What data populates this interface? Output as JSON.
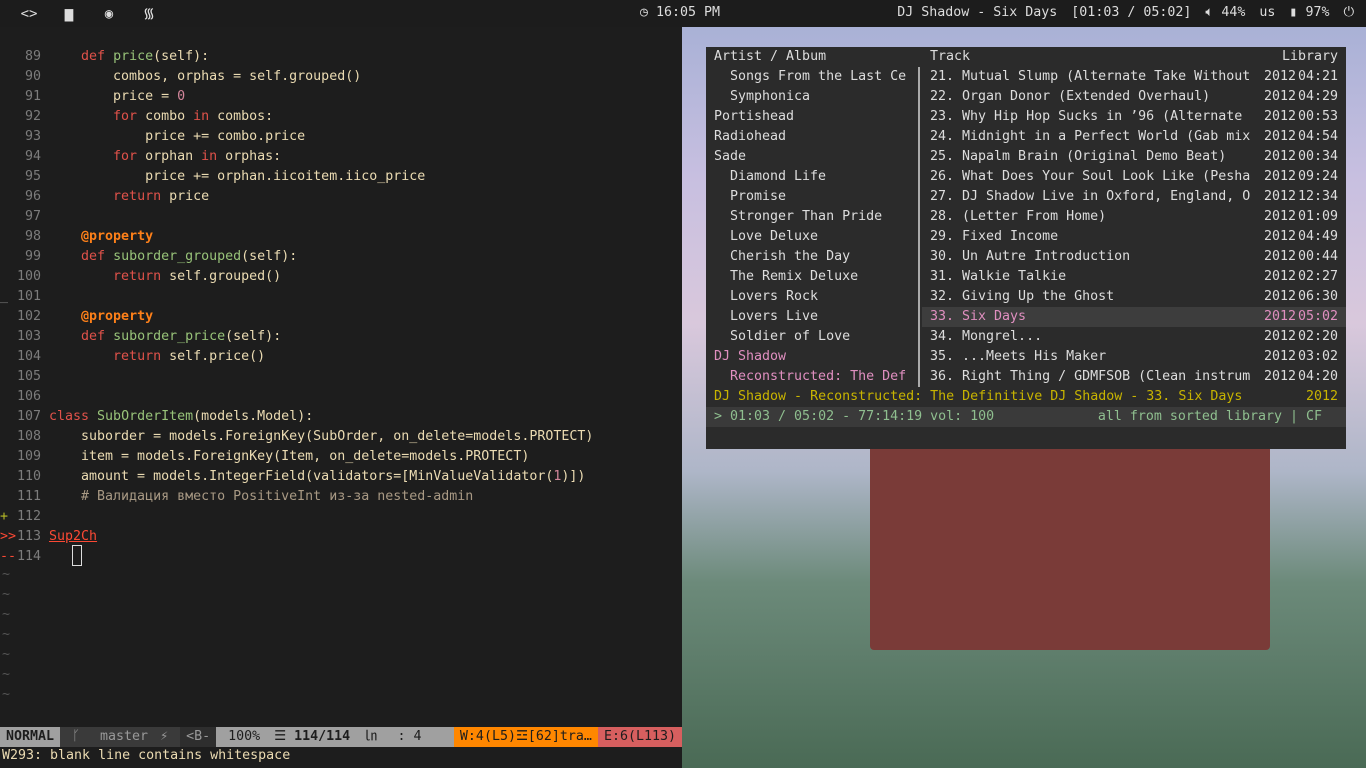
{
  "topbar": {
    "left_icons": [
      "code-icon",
      "folder-icon",
      "compass-icon",
      "rss-icon"
    ],
    "clock": "16:05 PM",
    "now_playing": "DJ Shadow - Six Days",
    "progress": "[01:03 / 05:02]",
    "volume": "44%",
    "layout": "us",
    "battery": "97%"
  },
  "editor": {
    "lines": [
      {
        "n": "89",
        "s": "",
        "t": [
          [
            "    ",
            ""
          ],
          [
            "def",
            "kw"
          ],
          [
            " ",
            ""
          ],
          [
            "price",
            "fn"
          ],
          [
            "(self):",
            ""
          ]
        ]
      },
      {
        "n": "90",
        "s": "",
        "t": [
          [
            "        combos, orphas = self.grouped()",
            ""
          ]
        ]
      },
      {
        "n": "91",
        "s": "",
        "t": [
          [
            "        price = ",
            ""
          ],
          [
            "0",
            "num"
          ]
        ]
      },
      {
        "n": "92",
        "s": "",
        "t": [
          [
            "        ",
            ""
          ],
          [
            "for",
            "kw"
          ],
          [
            " combo ",
            ""
          ],
          [
            "in",
            "kw"
          ],
          [
            " combos:",
            ""
          ]
        ]
      },
      {
        "n": "93",
        "s": "",
        "t": [
          [
            "            price += combo.price",
            ""
          ]
        ]
      },
      {
        "n": "94",
        "s": "",
        "t": [
          [
            "        ",
            ""
          ],
          [
            "for",
            "kw"
          ],
          [
            " orphan ",
            ""
          ],
          [
            "in",
            "kw"
          ],
          [
            " orphas:",
            ""
          ]
        ]
      },
      {
        "n": "95",
        "s": "",
        "t": [
          [
            "            price += orphan.iicoitem.iico_price",
            ""
          ]
        ]
      },
      {
        "n": "96",
        "s": "",
        "t": [
          [
            "        ",
            ""
          ],
          [
            "return",
            "kw"
          ],
          [
            " price",
            ""
          ]
        ]
      },
      {
        "n": "97",
        "s": "",
        "t": []
      },
      {
        "n": "98",
        "s": "",
        "t": [
          [
            "    ",
            ""
          ],
          [
            "@property",
            "dec"
          ]
        ]
      },
      {
        "n": "99",
        "s": "",
        "t": [
          [
            "    ",
            ""
          ],
          [
            "def",
            "kw"
          ],
          [
            " ",
            ""
          ],
          [
            "suborder_grouped",
            "fn"
          ],
          [
            "(self):",
            ""
          ]
        ]
      },
      {
        "n": "100",
        "s": "",
        "t": [
          [
            "        ",
            ""
          ],
          [
            "return",
            "kw"
          ],
          [
            " self.grouped()",
            ""
          ]
        ]
      },
      {
        "n": "101",
        "s": "_",
        "t": []
      },
      {
        "n": "102",
        "s": "",
        "t": [
          [
            "    ",
            ""
          ],
          [
            "@property",
            "dec"
          ]
        ]
      },
      {
        "n": "103",
        "s": "",
        "t": [
          [
            "    ",
            ""
          ],
          [
            "def",
            "kw"
          ],
          [
            " ",
            ""
          ],
          [
            "suborder_price",
            "fn"
          ],
          [
            "(self):",
            ""
          ]
        ]
      },
      {
        "n": "104",
        "s": "",
        "t": [
          [
            "        ",
            ""
          ],
          [
            "return",
            "kw"
          ],
          [
            " self.price()",
            ""
          ]
        ]
      },
      {
        "n": "105",
        "s": "",
        "t": []
      },
      {
        "n": "106",
        "s": "",
        "t": []
      },
      {
        "n": "107",
        "s": "",
        "t": [
          [
            "class",
            "kw"
          ],
          [
            " ",
            ""
          ],
          [
            "SubOrderItem",
            "fn"
          ],
          [
            "(models.Model):",
            ""
          ]
        ]
      },
      {
        "n": "108",
        "s": "",
        "t": [
          [
            "    suborder = models.ForeignKey(SubOrder, on_delete=models.PROTECT)",
            ""
          ]
        ]
      },
      {
        "n": "109",
        "s": "",
        "t": [
          [
            "    item = models.ForeignKey(Item, on_delete=models.PROTECT)",
            ""
          ]
        ]
      },
      {
        "n": "110",
        "s": "",
        "t": [
          [
            "    amount = models.IntegerField(validators=[MinValueValidator(",
            ""
          ],
          [
            "1",
            "num"
          ],
          [
            ")])",
            ""
          ]
        ]
      },
      {
        "n": "111",
        "s": "",
        "t": [
          [
            "    # Валидация вместо PositiveInt из-за nested-admin",
            "cm"
          ]
        ]
      },
      {
        "n": "112",
        "s": "+",
        "t": []
      },
      {
        "n": "113",
        "s": ">>",
        "t": [
          [
            "Sup2Ch",
            "err"
          ]
        ]
      },
      {
        "n": "114",
        "s": "--",
        "t": []
      }
    ]
  },
  "statusline": {
    "mode": "NORMAL",
    "branch": "master",
    "branch_icon": "⚡",
    "buffer": "<B-",
    "percent": "100%",
    "position": "114/114",
    "ln_icon": "㏑",
    "col": ":  4",
    "warnings": "W:4(L5)☲[62]tra…",
    "errors": "E:6(L113)"
  },
  "message": "W293: blank line contains whitespace",
  "cmus": {
    "headers": {
      "artist": "Artist / Album",
      "track": "Track",
      "library": "Library"
    },
    "artists": [
      {
        "name": "Songs From the Last Ce",
        "indent": true
      },
      {
        "name": "Symphonica",
        "indent": true
      },
      {
        "name": "Portishead",
        "indent": false
      },
      {
        "name": "Radiohead",
        "indent": false
      },
      {
        "name": "Sade",
        "indent": false
      },
      {
        "name": "Diamond Life",
        "indent": true
      },
      {
        "name": "Promise",
        "indent": true
      },
      {
        "name": "Stronger Than Pride",
        "indent": true
      },
      {
        "name": "Love Deluxe",
        "indent": true
      },
      {
        "name": "Cherish the Day",
        "indent": true
      },
      {
        "name": "The Remix Deluxe",
        "indent": true
      },
      {
        "name": "Lovers Rock",
        "indent": true
      },
      {
        "name": "Lovers Live",
        "indent": true
      },
      {
        "name": "Soldier of Love",
        "indent": true
      },
      {
        "name": "DJ Shadow",
        "indent": false,
        "hl": true
      },
      {
        "name": "Reconstructed: The Def",
        "indent": true,
        "hl": true
      }
    ],
    "tracks": [
      {
        "title": "21. Mutual Slump (Alternate Take Without",
        "year": "2012",
        "dur": "04:21"
      },
      {
        "title": "22. Organ Donor (Extended Overhaul)",
        "year": "2012",
        "dur": "04:29"
      },
      {
        "title": "23. Why Hip Hop Sucks in ’96 (Alternate",
        "year": "2012",
        "dur": "00:53"
      },
      {
        "title": "24. Midnight in a Perfect World (Gab mix",
        "year": "2012",
        "dur": "04:54"
      },
      {
        "title": "25. Napalm Brain (Original Demo Beat)",
        "year": "2012",
        "dur": "00:34"
      },
      {
        "title": "26. What Does Your Soul Look Like (Pesha",
        "year": "2012",
        "dur": "09:24"
      },
      {
        "title": "27. DJ Shadow Live in Oxford, England, O",
        "year": "2012",
        "dur": "12:34"
      },
      {
        "title": "28. (Letter From Home)",
        "year": "2012",
        "dur": "01:09"
      },
      {
        "title": "29. Fixed Income",
        "year": "2012",
        "dur": "04:49"
      },
      {
        "title": "30. Un Autre Introduction",
        "year": "2012",
        "dur": "00:44"
      },
      {
        "title": "31. Walkie Talkie",
        "year": "2012",
        "dur": "02:27"
      },
      {
        "title": "32. Giving Up the Ghost",
        "year": "2012",
        "dur": "06:30"
      },
      {
        "title": "33. Six Days",
        "year": "2012",
        "dur": "05:02",
        "playing": true
      },
      {
        "title": "34. Mongrel...",
        "year": "2012",
        "dur": "02:20"
      },
      {
        "title": "35. ...Meets His Maker",
        "year": "2012",
        "dur": "03:02"
      },
      {
        "title": "36. Right Thing / GDMFSOB (Clean instrum",
        "year": "2012",
        "dur": "04:20"
      }
    ],
    "now_line": "DJ Shadow - Reconstructed: The Definitive DJ Shadow - 33. Six Days",
    "now_year": "2012",
    "status_left": "> 01:03 / 05:02 - 77:14:19 vol: 100",
    "status_right": "all from sorted library | CF",
    "colors": {
      "highlight": "#e08fc0",
      "nowplaying": "#c8b400"
    }
  }
}
